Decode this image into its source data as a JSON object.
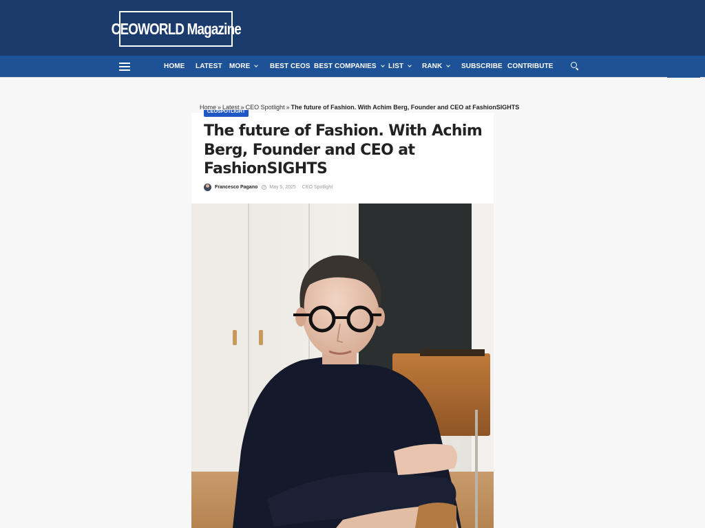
{
  "site": {
    "logo_text": "CEOWORLD Magazine"
  },
  "nav": {
    "items": [
      {
        "label": "HOME",
        "dropdown": false
      },
      {
        "label": "LATEST",
        "dropdown": false
      },
      {
        "label": "MORE",
        "dropdown": true
      },
      {
        "label": "BEST CEOS",
        "dropdown": false
      },
      {
        "label": "BEST COMPANIES",
        "dropdown": true
      },
      {
        "label": "LIST",
        "dropdown": true
      },
      {
        "label": "RANK",
        "dropdown": true
      },
      {
        "label": "SUBSCRIBE",
        "dropdown": false
      },
      {
        "label": "CONTRIBUTE",
        "dropdown": false
      }
    ],
    "menu_icon": "hamburger-icon",
    "search_icon": "search-icon"
  },
  "breadcrumb": {
    "items": [
      "Home",
      "Latest",
      "CEO Spotlight"
    ],
    "separator": "»",
    "current": "The future of Fashion. With Achim Berg, Founder and CEO at FashionSIGHTS"
  },
  "article": {
    "category_badge": "CEOSPOTLIGHT",
    "title": "The future of Fashion. With Achim Berg, Founder and CEO at FashionSIGHTS",
    "author": "Francesco Pagano",
    "date": "May 5, 2025",
    "category": "CEO Spotlight"
  },
  "colors": {
    "header_bg": "#1a3b6b",
    "nav_bg": "#1e5297",
    "badge_bg": "#1f57c5",
    "page_bg": "#f7f7f7"
  }
}
